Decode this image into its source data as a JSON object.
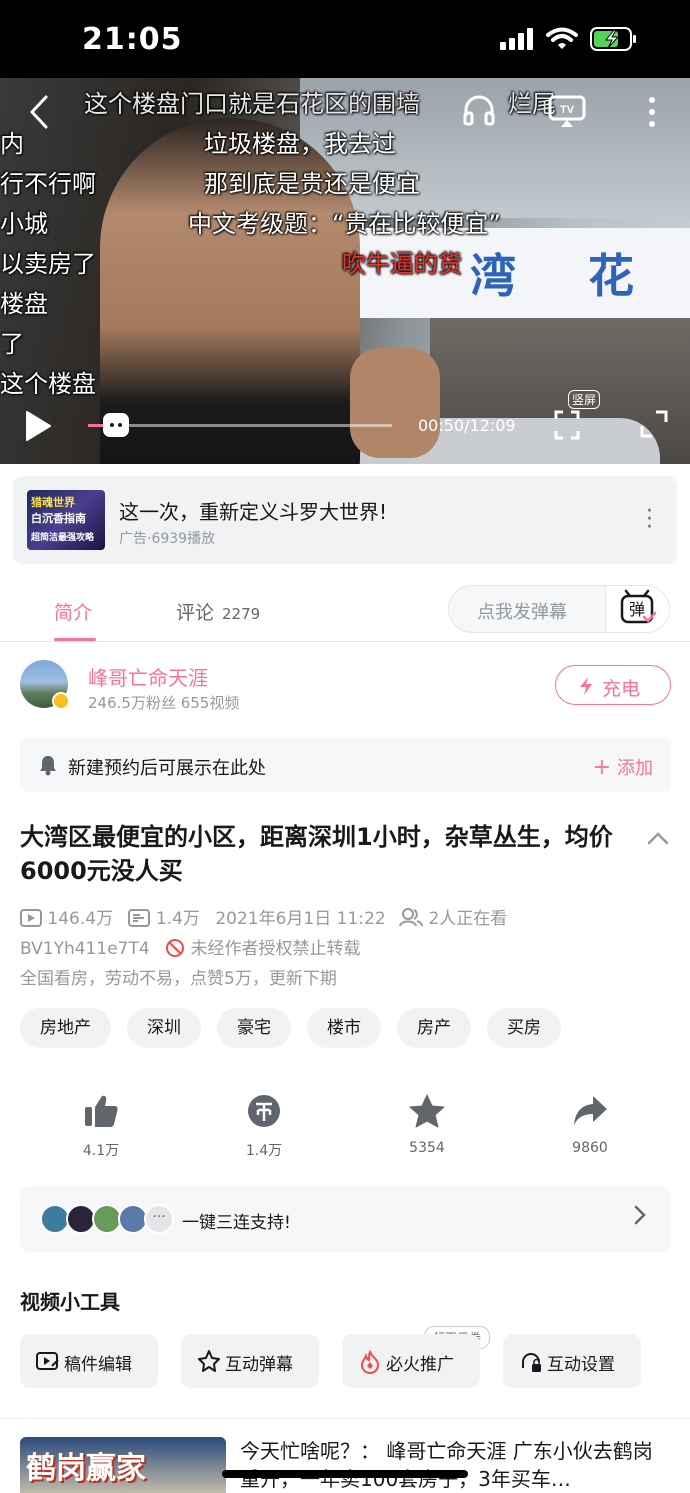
{
  "status_bar": {
    "time": "21:05"
  },
  "video": {
    "time_display": "00:50/12:09",
    "progress_fraction": 0.069,
    "portrait_label": "竖屏",
    "sign_text": [
      "湾",
      "花"
    ],
    "danmaku": [
      {
        "text": "这个楼盘门口就是石花区的围墙",
        "color": "gray"
      },
      {
        "text": "烂尾",
        "color": "gray"
      },
      {
        "text": "垃圾楼盘，我去过",
        "color": "gray"
      },
      {
        "text": "行不行啊",
        "color": "white"
      },
      {
        "text": "那到底是贵还是便宜",
        "color": "white"
      },
      {
        "text": "小城",
        "color": "white"
      },
      {
        "text": "中文考级题：“贵在比较便宜”",
        "color": "white"
      },
      {
        "text": "以卖房了",
        "color": "white"
      },
      {
        "text": "吹牛逼的货",
        "color": "red"
      },
      {
        "text": "楼盘",
        "color": "white"
      },
      {
        "text": "了",
        "color": "white"
      },
      {
        "text": "这个楼盘",
        "color": "white"
      },
      {
        "text": "内",
        "color": "white"
      }
    ]
  },
  "ad": {
    "thumb_text": [
      "猎魂世界",
      "白沉香指南",
      "超简洁最强攻略"
    ],
    "title": "这一次，重新定义斗罗大世界!",
    "sub": "广告·6939播放"
  },
  "tabs": {
    "intro": "简介",
    "comments": "评论",
    "comment_count": "2279",
    "danmaku_placeholder": "点我发弹幕",
    "danmaku_icon_text": "弹"
  },
  "author": {
    "name": "峰哥亡命天涯",
    "stats": "246.5万粉丝  655视频",
    "charge_label": "充电"
  },
  "reminder": {
    "text": "新建预约后可展示在此处",
    "add_label": "添加"
  },
  "video_info": {
    "title": "大湾区最便宜的小区，距离深圳1小时，杂草丛生，均价6000元没人买",
    "plays": "146.4万",
    "danmaku_count": "1.4万",
    "datetime": "2021年6月1日 11:22",
    "watching": "2人正在看",
    "bvid": "BV1Yh411e7T4",
    "no_repost": "未经作者授权禁止转载",
    "description": "全国看房，劳动不易，点赞5万，更新下期"
  },
  "tags": [
    "房地产",
    "深圳",
    "豪宅",
    "楼市",
    "房产",
    "买房"
  ],
  "actions": {
    "like": "4.1万",
    "coin": "1.4万",
    "favorite": "5354",
    "share": "9860"
  },
  "triple": {
    "text": "一键三连支持!"
  },
  "tools": {
    "title": "视频小工具",
    "items": [
      "稿件编辑",
      "互动弹幕",
      "必火推广",
      "互动设置"
    ],
    "coupon": "领百元券"
  },
  "recommendation": {
    "thumb_text": "鹤岗赢家",
    "title": "今天忙啥呢？： 峰哥亡命天涯 广东小伙去鹤岗重开，一年卖100套房子，3年买车…"
  },
  "colors": {
    "accent": "#fb7299",
    "text": "#18191c",
    "muted": "#9499a0"
  }
}
